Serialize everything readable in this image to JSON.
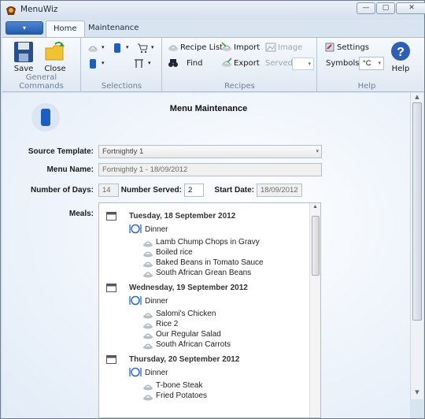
{
  "window": {
    "title": "MenuWiz",
    "minimize": "—",
    "maximize": "▢",
    "close": "✕"
  },
  "ribbon": {
    "tabs": [
      {
        "label": "Home"
      },
      {
        "label": "Maintenance"
      }
    ],
    "app_menu_symbol": "▾",
    "groups": {
      "general": {
        "label": "General Commands",
        "save": "Save",
        "close": "Close"
      },
      "selections": {
        "label": "Selections"
      },
      "recipes": {
        "label": "Recipes",
        "recipe_list": "Recipe List",
        "import": "Import",
        "image": "Image",
        "find": "Find",
        "export": "Export",
        "served": "Served"
      },
      "help": {
        "label": "Help",
        "settings": "Settings",
        "symbols": "Symbols",
        "unit": "°C",
        "help": "Help"
      }
    }
  },
  "form": {
    "title": "Menu Maintenance",
    "source_template_label": "Source Template:",
    "source_template_value": "Fortnightly 1",
    "menu_name_label": "Menu Name:",
    "menu_name_value": "Fortnightly 1 - 18/09/2012",
    "days_label": "Number of Days:",
    "days_value": "14",
    "served_label": "Number Served:",
    "served_value": "2",
    "start_label": "Start Date:",
    "start_value": "18/09/2012",
    "meals_label": "Meals:"
  },
  "meals": [
    {
      "date": "Tuesday, 18 September 2012",
      "meal": "Dinner",
      "dishes": [
        "Lamb Chump Chops in Gravy",
        "Boiled rice",
        "Baked Beans in Tomato Sauce",
        "South African Grean Beans"
      ]
    },
    {
      "date": "Wednesday, 19 September 2012",
      "meal": "Dinner",
      "dishes": [
        "Salomi's Chicken",
        "Rice 2",
        "Our Regular Salad",
        "South African Carrots"
      ]
    },
    {
      "date": "Thursday, 20 September 2012",
      "meal": "Dinner",
      "dishes": [
        "T-bone Steak",
        "Fried Potatoes"
      ]
    }
  ],
  "colors": {
    "accent": "#2259b0",
    "ribbon_bg": "#dfe8f3",
    "group_label": "#6e7f94"
  }
}
